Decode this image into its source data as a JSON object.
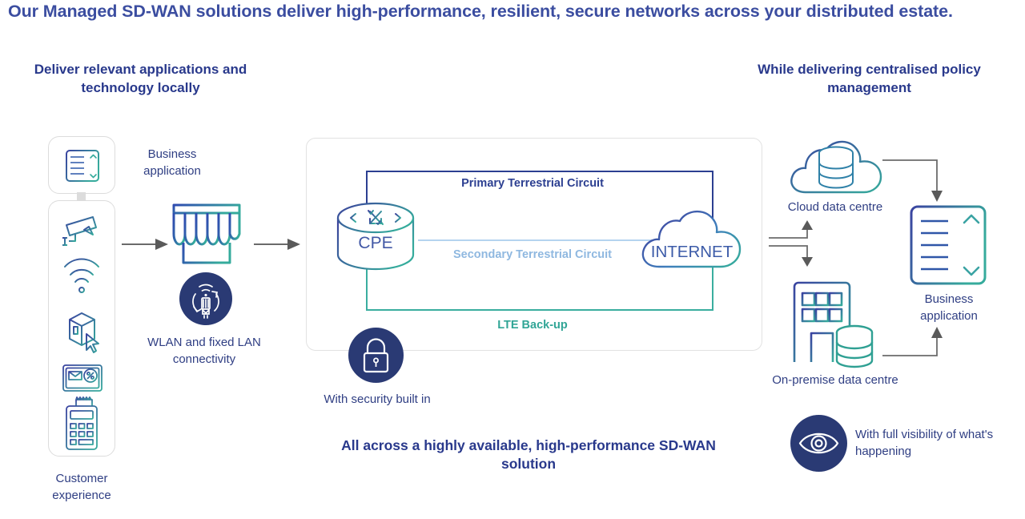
{
  "headline": "Our Managed SD-WAN solutions deliver high-performance, resilient, secure networks across your distributed estate.",
  "headings": {
    "left": "Deliver relevant applications and technology locally",
    "right": "While delivering centralised policy management"
  },
  "bottom_caption": "All across a highly available, high-performance SD-WAN solution",
  "left_column": {
    "business_application_label": "Business application",
    "customer_experience_label": "Customer experience",
    "icons": [
      "business-application-icon",
      "cctv-camera-icon",
      "wifi-signal-icon",
      "parcel-cursor-icon",
      "loyalty-card-icon",
      "payment-terminal-icon"
    ]
  },
  "store": {
    "wlan_label": "WLAN and fixed LAN connectivity",
    "icon": "storefront-icon",
    "badge_icon": "wireless-access-point-icon"
  },
  "security": {
    "label": "With security built in",
    "icon": "padlock-icon"
  },
  "central": {
    "cpe_label": "CPE",
    "internet_label": "INTERNET",
    "circuits": [
      {
        "id": "primary",
        "label": "Primary Terrestrial Circuit",
        "color": "#2c3f91"
      },
      {
        "id": "secondary",
        "label": "Secondary Terrestrial Circuit",
        "color": "#8fb8e0"
      },
      {
        "id": "lte",
        "label": "LTE Back-up",
        "color": "#31a596"
      }
    ]
  },
  "right_column": {
    "cloud_data_centre_label": "Cloud data centre",
    "on_premise_data_centre_label": "On-premise data centre",
    "business_application_label": "Business application",
    "visibility_label": "With full visibility of what's happening",
    "icons": [
      "cloud-database-icon",
      "office-building-database-icon",
      "business-application-icon",
      "eye-visibility-icon"
    ]
  },
  "colors": {
    "headline": "#3b4da0",
    "heading": "#29398c",
    "caption": "#2f3e83",
    "badge_navy": "#2a3a74",
    "gradient_start": "#3a43a0",
    "gradient_end": "#36ab9c",
    "arrow_grey": "#6b6b6b",
    "card_border": "#dcdcdc"
  }
}
